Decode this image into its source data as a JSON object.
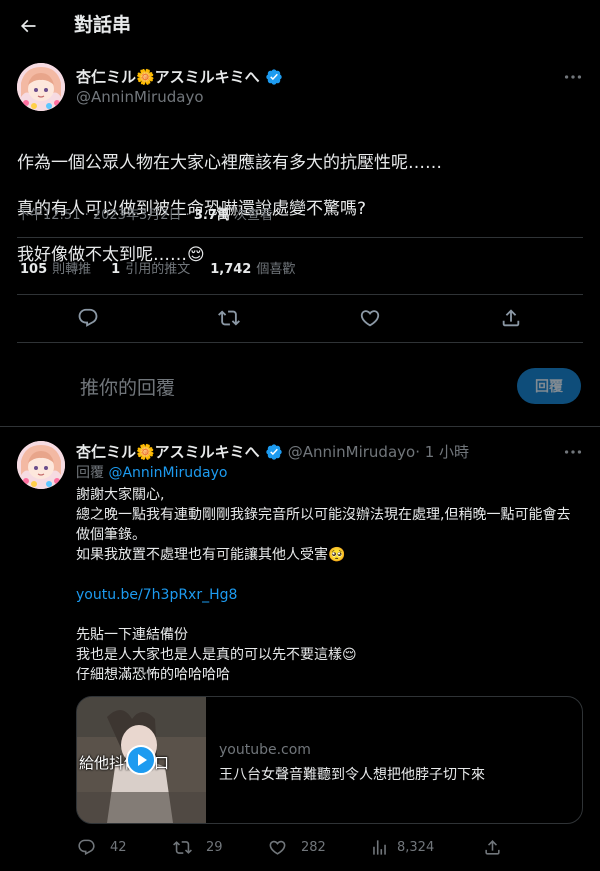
{
  "header": {
    "title": "對話串",
    "back_icon": "arrow-left-icon"
  },
  "main_tweet": {
    "display_name": "杏仁ミル🌼アスミルキミへ",
    "handle": "@AnninMirudayo",
    "text_lines": [
      "作為一個公眾人物在大家心裡應該有多大的抗壓性呢……",
      "真的有人可以做到被生命恐嚇還說處變不驚嗎?",
      "我好像做不太到呢……😌"
    ],
    "timestamp": "下午12:51 · 2023年3月2日 · ",
    "views_count": "3.7萬",
    "views_label": " 次查看",
    "stats": {
      "retweets_count": "105",
      "retweets_label": "則轉推",
      "quotes_count": "1",
      "quotes_label": "引用的推文",
      "likes_count": "1,742",
      "likes_label": "個喜歡"
    }
  },
  "reply_box": {
    "placeholder": "推你的回覆",
    "button_label": "回覆"
  },
  "reply_tweet": {
    "display_name": "杏仁ミル🌼アスミルキミへ",
    "handle": "@AnninMirudayo",
    "time": " · 1 小時",
    "replying_label": "回覆 ",
    "replying_to": "@AnninMirudayo",
    "body": {
      "l1": "謝謝大家關心,",
      "l2": "總之晚一點我有連動剛剛我錄完音所以可能沒辦法現在處理,但稍晚一點可能會去做個筆錄。",
      "l3": "如果我放置不處理也有可能讓其他人受害🥺",
      "link": "youtu.be/7h3pRxr_Hg8",
      "l5": "先貼一下連結備份",
      "l6": "我也是人大家也是人是真的可以先不要這樣😌",
      "l7": "仔細想滿恐怖的哈哈哈哈"
    },
    "card": {
      "thumb_caption": "給他抖個傷口",
      "domain": "youtube.com",
      "title": "王八台女聲音難聽到令人想把他脖子切下來"
    },
    "actions": {
      "reply_count": "42",
      "retweet_count": "29",
      "like_count": "282",
      "views_count": "8,324"
    }
  },
  "colors": {
    "background": "#000000",
    "text": "#e7e9ea",
    "muted": "#71767b",
    "accent": "#1d9bf0",
    "border": "#2f3336"
  }
}
